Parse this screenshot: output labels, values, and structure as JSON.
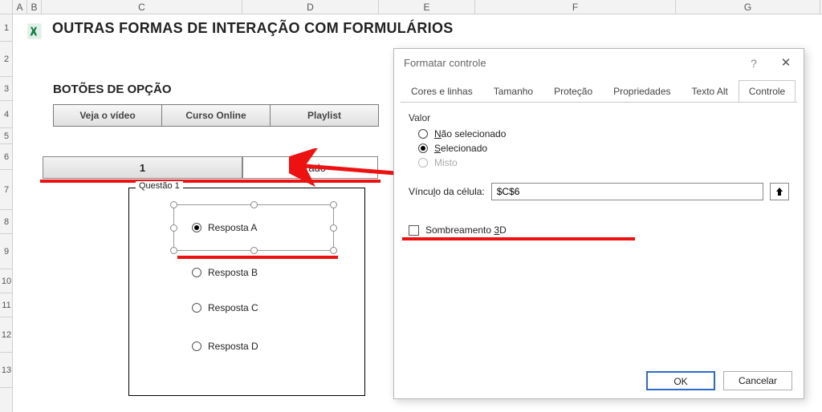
{
  "columns": [
    "A",
    "B",
    "C",
    "D",
    "E",
    "F",
    "G"
  ],
  "rows": [
    "1",
    "2",
    "3",
    "4",
    "5",
    "6",
    "7",
    "8",
    "9",
    "10",
    "11",
    "12",
    "13"
  ],
  "title": "OUTRAS FORMAS DE INTERAÇÃO COM FORMULÁRIOS",
  "section_title": "BOTÕES DE OPÇÃO",
  "toolbar": {
    "btn1": "Veja o vídeo",
    "btn2": "Curso Online",
    "btn3": "Playlist"
  },
  "linked_cell_value": "1",
  "result_label": "Errado",
  "group": {
    "legend": "Questão 1",
    "optA": "Resposta A",
    "optB": "Resposta B",
    "optC": "Resposta C",
    "optD": "Resposta D"
  },
  "dialog": {
    "title": "Formatar controle",
    "tabs": {
      "cores": "Cores e linhas",
      "tamanho": "Tamanho",
      "protecao": "Proteção",
      "propriedades": "Propriedades",
      "textoalt": "Texto Alt",
      "controle": "Controle"
    },
    "value_label": "Valor",
    "nao_sel": "Não selecionado",
    "sel": "Selecionado",
    "misto": "Misto",
    "link_label": "Vínculo da célula:",
    "link_value": "$C$6",
    "shade3d": "Sombreamento 3D",
    "ok": "OK",
    "cancel": "Cancelar"
  }
}
